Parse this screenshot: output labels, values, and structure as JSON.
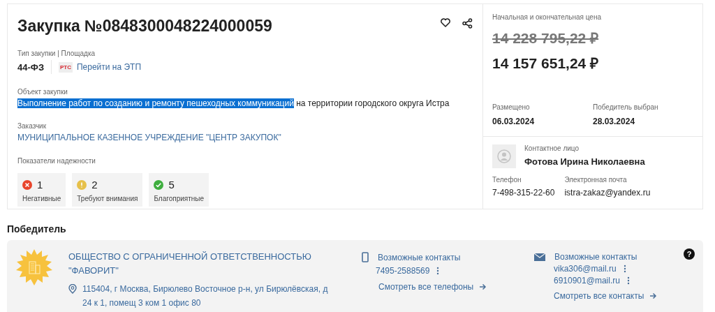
{
  "purchase": {
    "title": "Закупка №0848300048224000059",
    "type_label": "Тип закупки | Площадка",
    "law": "44-ФЗ",
    "platform_logo": "РТС",
    "platform_link": "Перейти на ЭТП",
    "subject_label": "Объект закупки",
    "subject_highlighted": "Выполнение работ по созданию и ремонту пешеходных коммуникаций",
    "subject_rest": " на территории городского округа Истра",
    "customer_label": "Заказчик",
    "customer": "МУНИЦИПАЛЬНОЕ КАЗЕННОЕ УЧРЕЖДЕНИЕ \"ЦЕНТР ЗАКУПОК\"",
    "reliability_label": "Показатели надежности",
    "reliability": [
      {
        "kind": "negative",
        "count": "1",
        "label": "Негативные",
        "color": "#e8452c"
      },
      {
        "kind": "warning",
        "count": "2",
        "label": "Требуют внимания",
        "color": "#e6c04a"
      },
      {
        "kind": "positive",
        "count": "5",
        "label": "Благоприятные",
        "color": "#3fae3f"
      }
    ],
    "favorite": false
  },
  "price": {
    "label": "Начальная и окончательная цена",
    "initial": "14 228 795,22 ₽",
    "final": "14 157 651,24 ₽"
  },
  "dates": [
    {
      "label": "Размещено",
      "value": "06.03.2024"
    },
    {
      "label": "Победитель выбран",
      "value": "28.03.2024"
    }
  ],
  "contact": {
    "label": "Контактное лицо",
    "name": "Фотова Ирина Николаевна",
    "phone_label": "Телефон",
    "phone": "7-498-315-22-60",
    "email_label": "Электронная почта",
    "email": "istra-zakaz@yandex.ru"
  },
  "winner": {
    "heading": "Победитель",
    "name": "ОБЩЕСТВО С ОГРАНИЧЕННОЙ ОТВЕТСТВЕННОСТЬЮ \"ФАВОРИТ\"",
    "address": "115404, г Москва, Бирюлево Восточное р-н, ул Бирюлёвская, д 24 к 1, помещ 3 ком 1 офис 80",
    "phones": {
      "title": "Возможные контакты",
      "items": [
        "7495-2588569"
      ],
      "more": "Смотреть все телефоны"
    },
    "emails": {
      "title": "Возможные контакты",
      "items": [
        "vika306@mail.ru",
        "6910901@mail.ru"
      ],
      "more": "Смотреть все контакты"
    },
    "help": "?"
  }
}
